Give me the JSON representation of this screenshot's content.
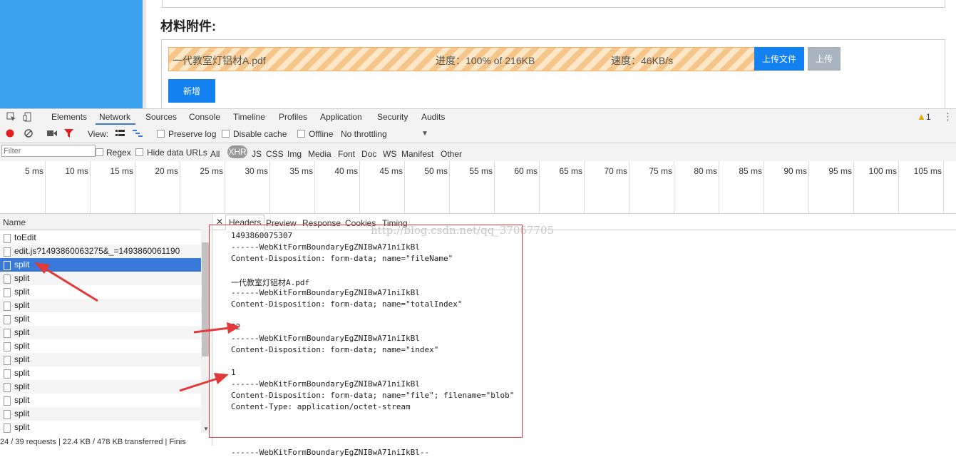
{
  "page": {
    "section_title": "材料附件:",
    "file_name": "一代教室灯铝材A.pdf",
    "progress_text": "进度：100% of 216KB",
    "speed_text": "速度：46KB/s",
    "progress_fraction": 1.0,
    "upload_file_button": "上传文件",
    "upload_button": "上传",
    "add_button": "新增",
    "accent_color": "#1481f0"
  },
  "devtools": {
    "tabs": [
      "Elements",
      "Network",
      "Sources",
      "Console",
      "Timeline",
      "Profiles",
      "Application",
      "Security",
      "Audits"
    ],
    "active_tab": "Network",
    "warning_count": "1",
    "toolbar": {
      "view_label": "View:",
      "preserve_log": "Preserve log",
      "disable_cache": "Disable cache",
      "offline": "Offline",
      "throttling": "No throttling"
    },
    "filter_bar": {
      "filter_placeholder": "Filter",
      "regex": "Regex",
      "hide_data_urls": "Hide data URLs",
      "types": [
        "All",
        "XHR",
        "JS",
        "CSS",
        "Img",
        "Media",
        "Font",
        "Doc",
        "WS",
        "Manifest",
        "Other"
      ],
      "active_type": "XHR"
    },
    "timeline_ticks": [
      "5 ms",
      "10 ms",
      "15 ms",
      "20 ms",
      "25 ms",
      "30 ms",
      "35 ms",
      "40 ms",
      "45 ms",
      "50 ms",
      "55 ms",
      "60 ms",
      "65 ms",
      "70 ms",
      "75 ms",
      "80 ms",
      "85 ms",
      "90 ms",
      "95 ms",
      "100 ms",
      "105 ms"
    ],
    "name_header": "Name",
    "requests": [
      "toEdit",
      "edit.js?1493860063275&_=1493860061190",
      "split",
      "split",
      "split",
      "split",
      "split",
      "split",
      "split",
      "split",
      "split",
      "split",
      "split",
      "split",
      "split"
    ],
    "selected_index": 2,
    "status_bar": "24 / 39 requests | 22.4 KB / 478 KB transferred | Finis",
    "detail_tabs": [
      "Headers",
      "Preview",
      "Response",
      "Cookies",
      "Timing"
    ],
    "active_detail_tab": "Headers",
    "payload_lines": [
      "1493860075307",
      "------WebKitFormBoundaryEgZNIBwA71niIkBl",
      "Content-Disposition: form-data; name=\"fileName\"",
      "",
      "一代教室灯铝材A.pdf",
      "------WebKitFormBoundaryEgZNIBwA71niIkBl",
      "Content-Disposition: form-data; name=\"totalIndex\"",
      "",
      "22",
      "------WebKitFormBoundaryEgZNIBwA71niIkBl",
      "Content-Disposition: form-data; name=\"index\"",
      "",
      "1",
      "------WebKitFormBoundaryEgZNIBwA71niIkBl",
      "Content-Disposition: form-data; name=\"file\"; filename=\"blob\"",
      "Content-Type: application/octet-stream",
      "",
      "",
      "",
      "------WebKitFormBoundaryEgZNIBwA71niIkBl--"
    ],
    "watermark": "http://blog.csdn.net/qq_37067705",
    "annotation_color": "#e23a3a"
  }
}
